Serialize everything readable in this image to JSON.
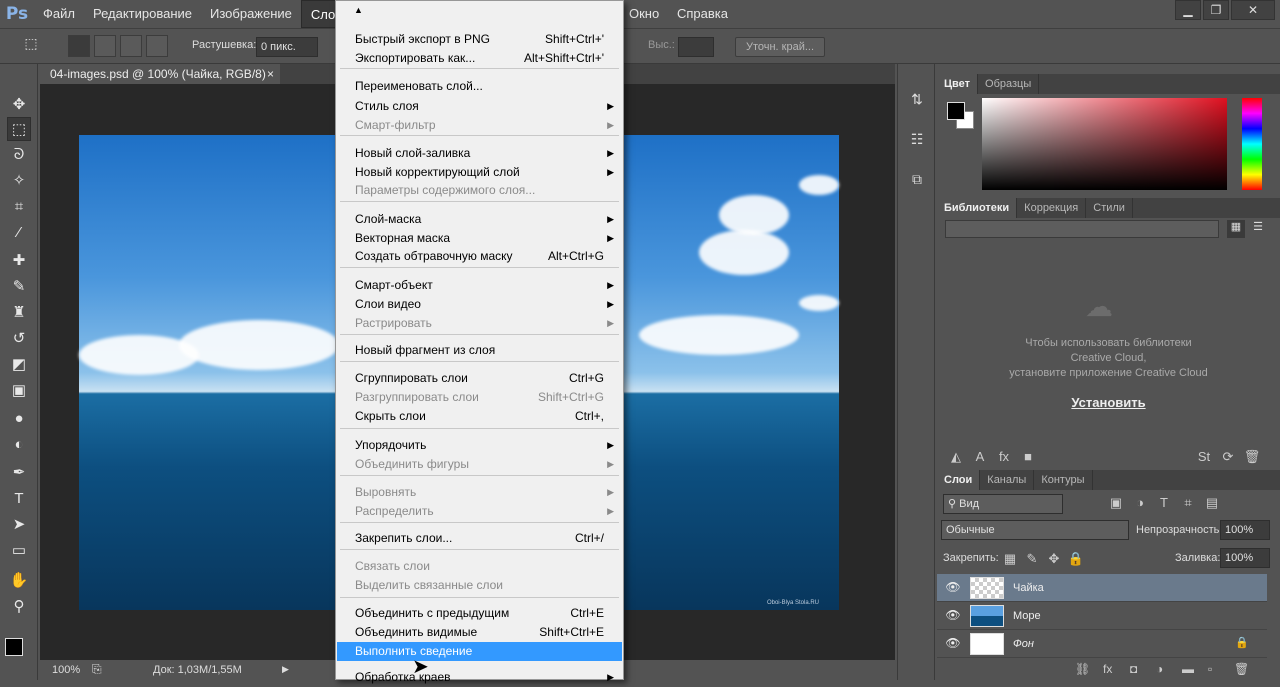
{
  "menubar": {
    "logo": "Ps",
    "items": [
      "Файл",
      "Редактирование",
      "Изображение",
      "Слои",
      "",
      "",
      "",
      "",
      "Окно",
      "Справка"
    ],
    "after": [
      "Окно",
      "Справка"
    ]
  },
  "window": {
    "minimize": "▁",
    "restore": "❐",
    "close": "✕"
  },
  "options": {
    "feather_label": "Растушевка:",
    "feather_value": "0 пикс.",
    "height_label": "Выс.:",
    "refine_button": "Уточн. край..."
  },
  "document": {
    "tab_title": "04-images.psd @ 100% (Чайка, RGB/8)",
    "close": "×",
    "watermark": "Oboi-Blya Stola.RU"
  },
  "status": {
    "zoom": "100%",
    "doc": "Док: 1,03М/1,55М"
  },
  "color_panel": {
    "tabs": [
      "Цвет",
      "Образцы"
    ]
  },
  "libraries_panel": {
    "tabs": [
      "Библиотеки",
      "Коррекция",
      "Стили"
    ],
    "message_line1": "Чтобы использовать библиотеки",
    "message_line2": "Creative Cloud,",
    "message_line3": "установите приложение Creative Cloud",
    "install_link": "Установить"
  },
  "layers_panel": {
    "tabs": [
      "Слои",
      "Каналы",
      "Контуры"
    ],
    "filter_label": "Вид",
    "blend_mode": "Обычные",
    "opacity_label": "Непрозрачность:",
    "opacity_value": "100%",
    "lock_label": "Закрепить:",
    "fill_label": "Заливка:",
    "fill_value": "100%",
    "layers": [
      {
        "name": "Чайка"
      },
      {
        "name": "Море"
      },
      {
        "name": "Фон"
      }
    ]
  },
  "menu": {
    "items": [
      {
        "label": "Быстрый экспорт в PNG",
        "shortcut": "Shift+Ctrl+'"
      },
      {
        "label": "Экспортировать как...",
        "shortcut": "Alt+Shift+Ctrl+'"
      },
      {
        "label": "Переименовать слой..."
      },
      {
        "label": "Стиль слоя",
        "arrow": "▶"
      },
      {
        "label": "Смарт-фильтр",
        "arrow": "▶"
      },
      {
        "label": "Новый слой-заливка",
        "arrow": "▶"
      },
      {
        "label": "Новый корректирующий слой",
        "arrow": "▶"
      },
      {
        "label": "Параметры содержимого слоя..."
      },
      {
        "label": "Слой-маска",
        "arrow": "▶"
      },
      {
        "label": "Векторная маска",
        "arrow": "▶"
      },
      {
        "label": "Создать обтравочную маску",
        "shortcut": "Alt+Ctrl+G"
      },
      {
        "label": "Смарт-объект",
        "arrow": "▶"
      },
      {
        "label": "Слои видео",
        "arrow": "▶"
      },
      {
        "label": "Растрировать",
        "arrow": "▶"
      },
      {
        "label": "Новый фрагмент из слоя"
      },
      {
        "label": "Сгруппировать слои",
        "shortcut": "Ctrl+G"
      },
      {
        "label": "Разгруппировать слои",
        "shortcut": "Shift+Ctrl+G"
      },
      {
        "label": "Скрыть слои",
        "shortcut": "Ctrl+,"
      },
      {
        "label": "Упорядочить",
        "arrow": "▶"
      },
      {
        "label": "Объединить фигуры",
        "arrow": "▶"
      },
      {
        "label": "Выровнять",
        "arrow": "▶"
      },
      {
        "label": "Распределить",
        "arrow": "▶"
      },
      {
        "label": "Закрепить слои...",
        "shortcut": "Ctrl+/"
      },
      {
        "label": "Связать слои"
      },
      {
        "label": "Выделить связанные слои"
      },
      {
        "label": "Объединить с предыдущим",
        "shortcut": "Ctrl+E"
      },
      {
        "label": "Объединить видимые",
        "shortcut": "Shift+Ctrl+E"
      },
      {
        "label": "Выполнить сведение"
      },
      {
        "label": "Обработка краев",
        "arrow": "▶"
      }
    ]
  },
  "icons": {
    "move": "move-icon",
    "marquee": "marquee-icon",
    "lasso": "lasso-icon"
  }
}
